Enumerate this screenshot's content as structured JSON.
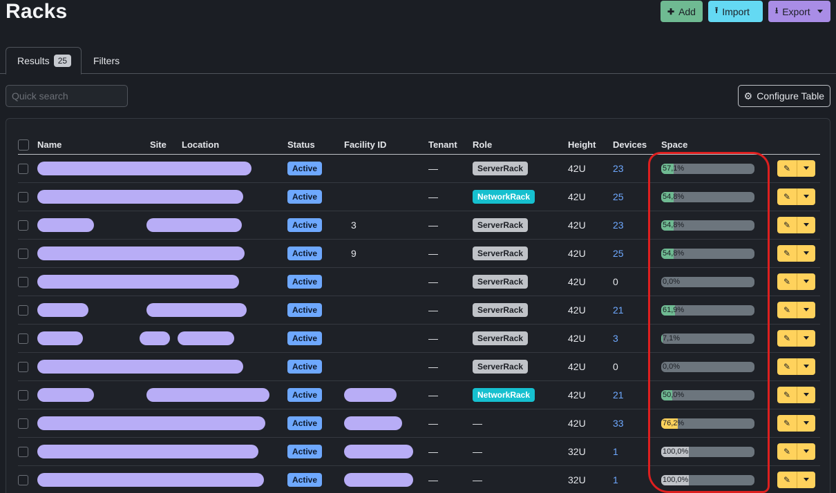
{
  "page_title": "Racks",
  "actions": {
    "add_label": "Add",
    "import_label": "Import",
    "export_label": "Export"
  },
  "tabs": {
    "results_label": "Results",
    "results_count": "25",
    "filters_label": "Filters"
  },
  "search": {
    "placeholder": "Quick search"
  },
  "configure_label": "Configure Table",
  "table": {
    "headers": [
      "Name",
      "Site",
      "Location",
      "Status",
      "Facility ID",
      "Tenant",
      "Role",
      "Height",
      "Devices",
      "Space"
    ],
    "rows": [
      {
        "status": "Active",
        "tenant": "—",
        "role": "ServerRack",
        "role_type": "server",
        "height": "42U",
        "devices": "23",
        "space": "57,1%",
        "space_value": 57.1,
        "fill_color": "#6fba92"
      },
      {
        "status": "Active",
        "tenant": "—",
        "role": "NetworkRack",
        "role_type": "network",
        "height": "42U",
        "devices": "25",
        "space": "54,8%",
        "space_value": 54.8,
        "fill_color": "#6fba92"
      },
      {
        "status": "Active",
        "facility": "3",
        "tenant": "—",
        "role": "ServerRack",
        "role_type": "server",
        "height": "42U",
        "devices": "23",
        "space": "54,8%",
        "space_value": 54.8,
        "fill_color": "#6fba92"
      },
      {
        "status": "Active",
        "facility": "9",
        "tenant": "—",
        "role": "ServerRack",
        "role_type": "server",
        "height": "42U",
        "devices": "25",
        "space": "54,8%",
        "space_value": 54.8,
        "fill_color": "#6fba92"
      },
      {
        "status": "Active",
        "tenant": "—",
        "role": "ServerRack",
        "role_type": "server",
        "height": "42U",
        "devices": "0",
        "space": "0,0%",
        "space_value": 0,
        "fill_color": "#6fba92"
      },
      {
        "status": "Active",
        "tenant": "—",
        "role": "ServerRack",
        "role_type": "server",
        "height": "42U",
        "devices": "21",
        "space": "61,9%",
        "space_value": 61.9,
        "fill_color": "#6fba92"
      },
      {
        "status": "Active",
        "tenant": "—",
        "role": "ServerRack",
        "role_type": "server",
        "height": "42U",
        "devices": "3",
        "space": "7,1%",
        "space_value": 7.1,
        "fill_color": "#6fba92"
      },
      {
        "status": "Active",
        "tenant": "—",
        "role": "ServerRack",
        "role_type": "server",
        "height": "42U",
        "devices": "0",
        "space": "0,0%",
        "space_value": 0,
        "fill_color": "#6fba92"
      },
      {
        "status": "Active",
        "tenant": "—",
        "role": "NetworkRack",
        "role_type": "network",
        "height": "42U",
        "devices": "21",
        "space": "50,0%",
        "space_value": 50.0,
        "fill_color": "#6fba92"
      },
      {
        "status": "Active",
        "tenant": "—",
        "role": "—",
        "role_type": "none",
        "height": "42U",
        "devices": "33",
        "space": "76,2%",
        "space_value": 76.2,
        "fill_color": "#ffd25c"
      },
      {
        "status": "Active",
        "tenant": "—",
        "role": "—",
        "role_type": "none",
        "height": "32U",
        "devices": "1",
        "space": "100,0%",
        "space_value": 100.0,
        "fill_color": "#c0c3c8"
      },
      {
        "status": "Active",
        "tenant": "—",
        "role": "—",
        "role_type": "none",
        "height": "32U",
        "devices": "1",
        "space": "100,0%",
        "space_value": 100.0,
        "fill_color": "#c0c3c8"
      }
    ]
  }
}
